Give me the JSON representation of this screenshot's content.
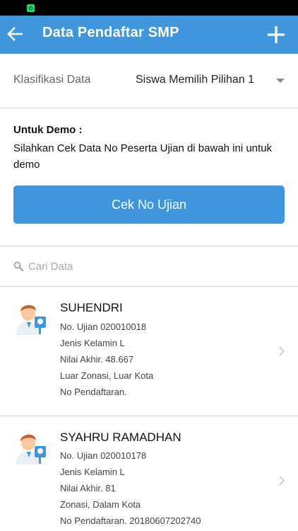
{
  "header": {
    "title": "Data Pendaftar SMP"
  },
  "icons": {
    "back": "arrow-left",
    "add": "plus",
    "search": "magnifier",
    "chevron": "chevron-right"
  },
  "colors": {
    "primary": "#3f96dc",
    "status_bar": "#000000",
    "divider": "#d6d6d6"
  },
  "filter": {
    "label": "Klasifikasi Data",
    "selected": "Siswa Memilih Pilihan 1"
  },
  "demo": {
    "title": "Untuk Demo :",
    "text": "Silahkan Cek Data No Peserta Ujian di bawah ini untuk demo",
    "button_label": "Cek No Ujian"
  },
  "search": {
    "placeholder": "Cari Data"
  },
  "students": [
    {
      "name": "SUHENDRI",
      "no_ujian": "No. Ujian 020010018",
      "jenis_kelamin": "Jenis Kelamin L",
      "nilai_akhir": "Nilai Akhir. 48.667",
      "zonasi": "Luar Zonasi, Luar Kota",
      "no_pendaftaran": "No Pendaftaran."
    },
    {
      "name": "SYAHRU RAMADHAN",
      "no_ujian": "No. Ujian 020010178",
      "jenis_kelamin": "Jenis Kelamin L",
      "nilai_akhir": "Nilai Akhir. 81",
      "zonasi": "Zonasi, Dalam Kota",
      "no_pendaftaran": "No Pendaftaran. 20180607202740"
    }
  ]
}
